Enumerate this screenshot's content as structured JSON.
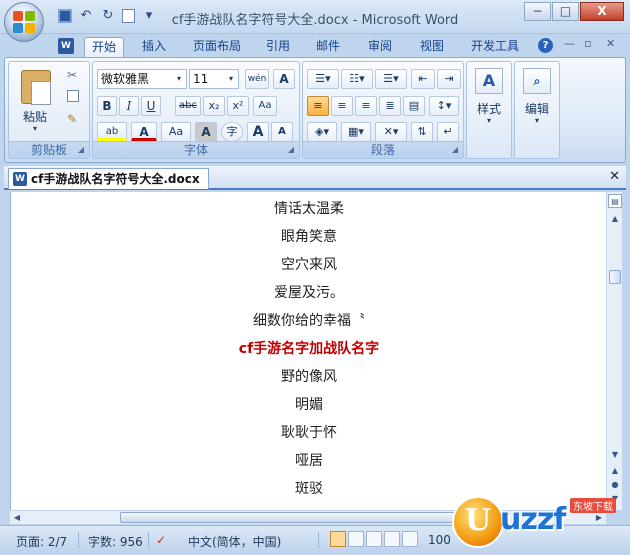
{
  "window": {
    "title": "cf手游战队名字符号大全.docx - Microsoft Word",
    "minimize": "−",
    "restore": "□",
    "close": "X"
  },
  "qat": {
    "undo": "↶",
    "redo": "↻",
    "more": "▾"
  },
  "tabs": [
    "开始",
    "插入",
    "页面布局",
    "引用",
    "邮件",
    "审阅",
    "视图",
    "开发工具"
  ],
  "help": "?",
  "ribbon": {
    "clipboard": {
      "label": "剪贴板",
      "paste": "粘贴"
    },
    "font": {
      "label": "字体",
      "font_name": "微软雅黑",
      "font_size": "11",
      "wen": "wén",
      "a_box": "A",
      "bold": "B",
      "italic": "I",
      "underline": "U",
      "strike": "abc",
      "subscript": "x₂",
      "superscript": "x²",
      "highlight": "ab",
      "font_color": "A",
      "change_case": "Aa",
      "char_shade": "A",
      "enclose": "字",
      "grow": "A",
      "shrink": "A"
    },
    "paragraph": {
      "label": "段落"
    },
    "styles": {
      "label": "样式"
    },
    "editing": {
      "label": "编辑"
    }
  },
  "document": {
    "tab_title": "cf手游战队名字符号大全.docx",
    "lines": [
      {
        "text": "情话太温柔",
        "style": "normal"
      },
      {
        "text": "眼角笑意",
        "style": "normal"
      },
      {
        "text": "空穴来风",
        "style": "normal"
      },
      {
        "text": "爱屋及污。",
        "style": "normal"
      },
      {
        "text": "细数你给的幸福〝",
        "style": "normal"
      },
      {
        "text": "cf手游名字加战队名字",
        "style": "heading"
      },
      {
        "text": "野的像风",
        "style": "normal"
      },
      {
        "text": "明媚",
        "style": "normal"
      },
      {
        "text": "耿耿于怀",
        "style": "normal"
      },
      {
        "text": "哑居",
        "style": "normal"
      },
      {
        "text": "斑驳",
        "style": "normal"
      }
    ]
  },
  "status": {
    "page": "页面: 2/7",
    "words": "字数: 956",
    "language": "中文(简体，中国)",
    "zoom": "100"
  },
  "watermark": {
    "logo_letter": "U",
    "text": "uzzf",
    "tag": "东坡下载"
  }
}
